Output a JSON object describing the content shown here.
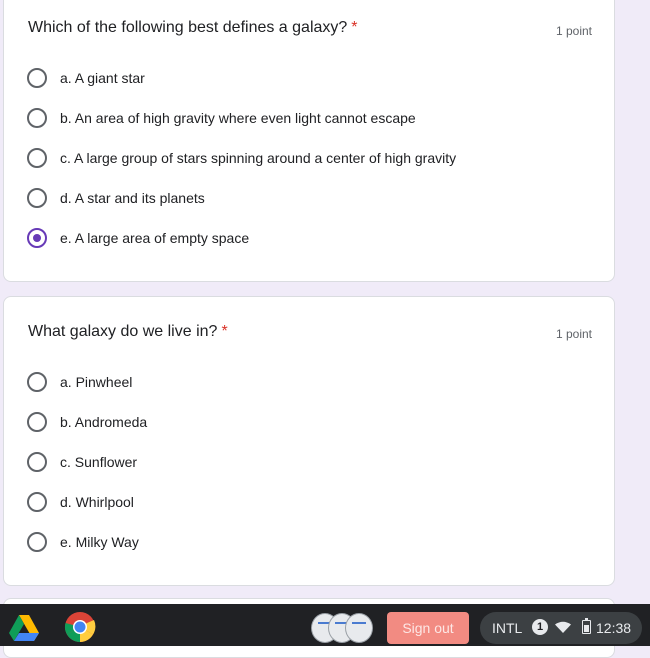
{
  "questions": [
    {
      "title": "Which of the following best defines a galaxy?",
      "required_mark": "*",
      "points": "1 point",
      "options": [
        {
          "label": "a. A giant star",
          "selected": false
        },
        {
          "label": "b. An area of high gravity where even light cannot escape",
          "selected": false
        },
        {
          "label": "c. A large group of stars spinning around a center of high gravity",
          "selected": false
        },
        {
          "label": "d. A star and its planets",
          "selected": false
        },
        {
          "label": "e. A large area of empty space",
          "selected": true
        }
      ]
    },
    {
      "title": "What galaxy do we live in?",
      "required_mark": "*",
      "points": "1 point",
      "options": [
        {
          "label": "a. Pinwheel",
          "selected": false
        },
        {
          "label": "b. Andromeda",
          "selected": false
        },
        {
          "label": "c. Sunflower",
          "selected": false
        },
        {
          "label": "d. Whirlpool",
          "selected": false
        },
        {
          "label": "e. Milky Way",
          "selected": false
        }
      ]
    }
  ],
  "shelf": {
    "apps": [
      {
        "name": "Google Drive",
        "icon": "google-drive-icon"
      },
      {
        "name": "Google Chrome",
        "icon": "chrome-icon"
      }
    ],
    "sign_out_label": "Sign out",
    "input_method": "INTL",
    "notification_count": "1",
    "clock": "12:38"
  },
  "colors": {
    "accent": "#673ab7",
    "page_background": "#f0ebf8",
    "required": "#d93025",
    "sign_out": "#f28b82"
  }
}
